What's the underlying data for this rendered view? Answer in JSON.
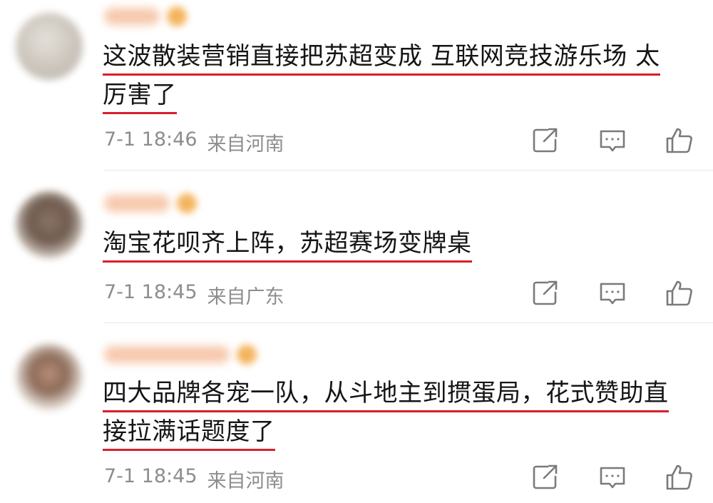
{
  "comments": [
    {
      "lines": [
        "这波散装营销直接把苏超变成 互联网竞技游乐场 太",
        "厉害了"
      ],
      "date": "7-1 18:46",
      "location": "来自河南"
    },
    {
      "lines": [
        "淘宝花呗齐上阵，苏超赛场变牌桌"
      ],
      "date": "7-1 18:45",
      "location": "来自广东"
    },
    {
      "lines": [
        "四大品牌各宠一队，从斗地主到掼蛋局，花式赞助直",
        "接拉满话题度了"
      ],
      "date": "7-1 18:45",
      "location": "来自河南"
    }
  ],
  "icons": {
    "share": "share-icon",
    "reply": "comment-icon",
    "like": "thumbs-up-icon"
  },
  "colors": {
    "underline": "#d81e2a",
    "meta_text": "#8d8d8d",
    "icon": "#7a7a7a"
  }
}
